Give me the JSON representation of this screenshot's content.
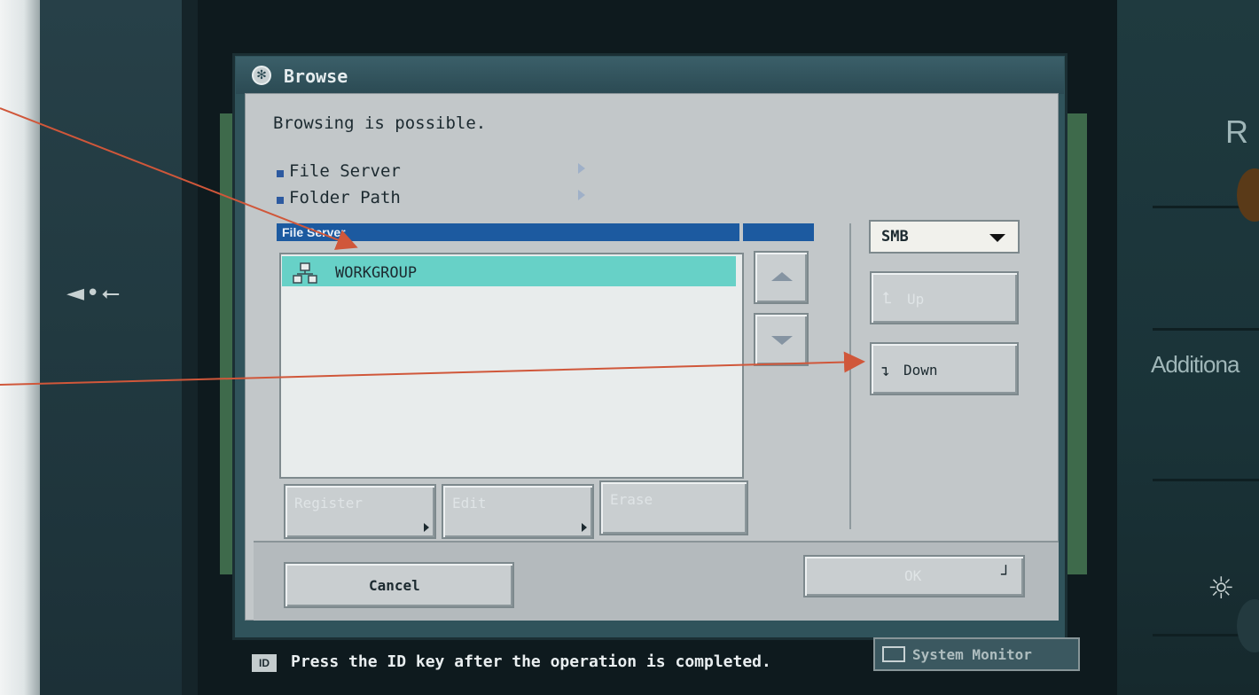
{
  "dialog": {
    "title": "Browse",
    "title_icon": "gear-icon",
    "message": "Browsing is possible.",
    "info": [
      {
        "label": "File Server"
      },
      {
        "label": "Folder Path"
      }
    ]
  },
  "list": {
    "header": "File Server",
    "items": [
      {
        "label": "WORKGROUP",
        "icon": "network-icon",
        "selected": true
      }
    ]
  },
  "protocol_select": {
    "value": "SMB"
  },
  "buttons": {
    "up": "Up",
    "down": "Down",
    "register": "Register",
    "edit": "Edit",
    "erase": "Erase",
    "cancel": "Cancel",
    "ok": "OK"
  },
  "status": {
    "id_key": "ID",
    "message": "Press the ID key after the operation is completed.",
    "system_monitor": "System Monitor"
  },
  "panel": {
    "right_labels": [
      "R",
      "Additiona"
    ]
  },
  "colors": {
    "annotation_arrow": "#d0573a",
    "selected_row": "#67d1c7",
    "list_header": "#1c5aa0"
  }
}
